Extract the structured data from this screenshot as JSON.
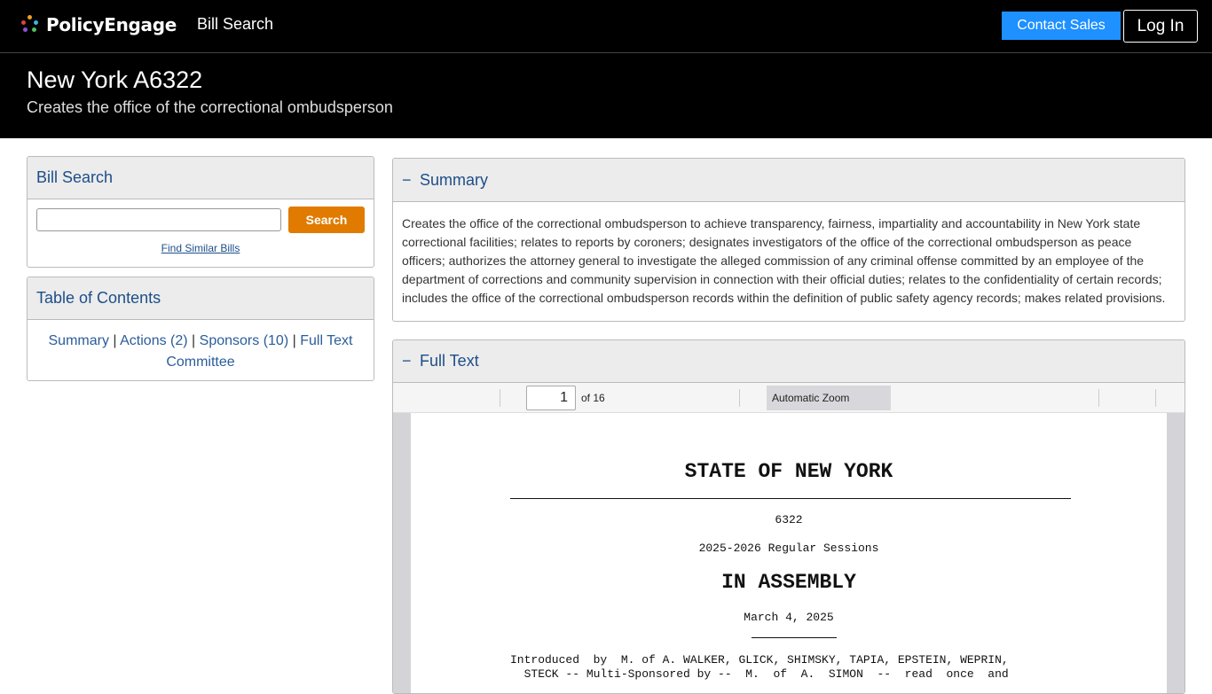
{
  "nav": {
    "brand": "PolicyEngage",
    "bill_search_link": "Bill Search",
    "contact_sales": "Contact Sales",
    "login": "Log In"
  },
  "hero": {
    "title": "New York A6322",
    "subtitle": "Creates the office of the correctional ombudsperson"
  },
  "bill_search": {
    "heading": "Bill Search",
    "input_value": "",
    "search_button": "Search",
    "similar_link": "Find Similar Bills"
  },
  "toc": {
    "heading": "Table of Contents",
    "links": {
      "summary": "Summary",
      "actions": "Actions (2)",
      "sponsors": "Sponsors (10)",
      "full_text": "Full Text",
      "committee": "Committee"
    },
    "separator": "|"
  },
  "summary": {
    "collapse_symbol": "−",
    "heading": "Summary",
    "text": "Creates the office of the correctional ombudsperson to achieve transparency, fairness, impartiality and accountability in New York state correctional facilities; relates to reports by coroners; designates investigators of the office of the correctional ombudsperson as peace officers; authorizes the attorney general to investigate the alleged commission of any criminal offense committed by an employee of the department of corrections and community supervision in connection with their official duties; relates to the confidentiality of certain records; includes the office of the correctional ombudsperson records within the definition of public safety agency records; makes related provisions."
  },
  "full_text": {
    "collapse_symbol": "−",
    "heading": "Full Text",
    "viewer": {
      "page_number": "1",
      "page_count_label": "of 16",
      "zoom": "Automatic Zoom"
    },
    "document": {
      "state": "STATE OF NEW YORK",
      "bill_number": "6322",
      "session": "2025-2026 Regular Sessions",
      "chamber": "IN ASSEMBLY",
      "date": "March 4, 2025",
      "intro_line1": "Introduced  by  M. of A. WALKER, GLICK, SHIMSKY, TAPIA, EPSTEIN, WEPRIN,",
      "intro_line2": "  STECK -- Multi-Sponsored by --  M.  of  A.  SIMON  --  read  once  and"
    }
  },
  "colors": {
    "header_bg": "#000000",
    "contact_button": "#1e90ff",
    "search_button": "#e07b00",
    "link_blue": "#1d4e89"
  }
}
